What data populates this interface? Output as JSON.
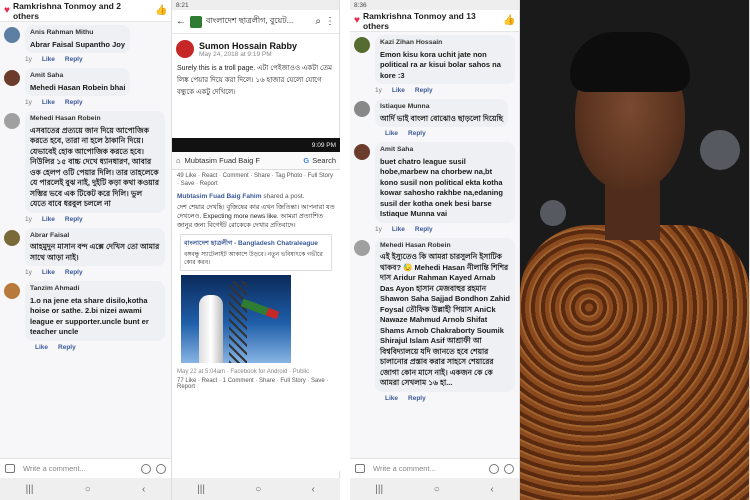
{
  "panel1": {
    "header": "Ramkrishna Tonmoy and 2 others",
    "comments": [
      {
        "name": "Anis Rahman Mithu",
        "text": "Abrar Faisal Supantho Joy",
        "time": "1y",
        "avatar": "#5c7fa3"
      },
      {
        "name": "Amit Saha",
        "text": "Mehedi Hasan Robein bhai",
        "time": "1y",
        "avatar": "#6b3b2b"
      },
      {
        "name": "Mehedi Hasan Robein",
        "text": "এসবাতের প্রত্যয়ে জান দিয়ে আপোজিক করতে হবে, তারা না হলে ঠাকানি দিয়ে। যেভাবেই হোক আপোজিক করতে হবে। নিউলির ১৫ বাচ্চ দেখে ধ্যানধারণ, আবার ওক হেলপ ওটি পেয়ার দিলি। তার তাহলেকে যে পারলেই বুঝ নাই, দুইটি কড়া কথা কওয়ার সম্ভির ভবে এক টিকেট করে দিলি। ভুল যেতে বাবে ধরবুল চললে না",
        "time": "1y",
        "avatar": "#a0a0a0"
      },
      {
        "name": "Abrar Faisal",
        "text": "আহমুদুন মাসান বন্দ এক্সে দেখিস তো আমার সাথে আড়া নাই।",
        "time": "1y",
        "avatar": "#7a6a3a"
      },
      {
        "name": "Tanzim Ahmadi",
        "text": "1.o na jene eta share disilo,kotha hoise or sathe. 2.bi nizei awami league er supporter.uncle bunt er teacher uncle",
        "time": "",
        "avatar": "#b87a3a"
      }
    ],
    "like": "Like",
    "reply": "Reply",
    "write_comment": "Write a comment..."
  },
  "panel2": {
    "status": "8:21",
    "group_title": "বাংলাদেশ ছাত্রলীগ, বুয়েট...",
    "poster": "Sumon Hossain Rabby",
    "date": "May 24, 2018 at 9:19 PM",
    "post_text": "Surely this is a troll page. এটা পেইজাওও একটা তেম লিঙ্ক পেয়ার দিয়ে করা দিলে। ১৬ হাজার যেলো যোগে বন্ধুকে একটু দেখিলে।",
    "inner_status": "9:09 PM",
    "url_name": "Mubtasim Fuad Baig F",
    "search": "Search",
    "reacts": "49 Like · React · Comment · Share · Tag Photo · Full Story · Save · Report",
    "share_line": "Mubtasim Fuad Baig Fahim",
    "share_suffix": "shared a post.",
    "inner_text": "দেশ শেয়ার দেখছি। বুজিষের কার এখন জিতিন্তা। আপনারা যত দেখলেও. Expecting more news like. আমরা প্রত্যাশিত জানুর জন্য বিগেইট রোকেকে দেখার প্রতিবাদে।",
    "embed_title": "বাংলাদেশ ছাত্রলীগ - Bangladesh Chatraleague",
    "embed_body": "বঙ্গবন্ধু স্যাটেলাইট আকাশে উড়বে। নতুন ভবিষ্যৎকে গভীরে কোর করব।",
    "footer": "May 22 at 5:04am · Facebook for Android · Public",
    "footer_acts": "77 Like · React · 1 Comment · Share · Full Story · Save · Report"
  },
  "panel3": {
    "status": "8:36",
    "header": "Ramkrishna Tonmoy and 13 others",
    "comments": [
      {
        "name": "Kazi Zihan Hossain",
        "text": "Emon kisu kora uchit jate non political ra ar kisui bolar sahos na kore :3",
        "time": "1y",
        "avatar": "#556b2f"
      },
      {
        "name": "Istiaque Munna",
        "text": "আর্দি ভাই বাংলা বোঝোও ছাড়লো দিয়েছি",
        "time": "",
        "avatar": "#888"
      },
      {
        "name": "Amit Saha",
        "text": "buet chatro league susil hobe,marbew na chorbew na,bt kono susil non political ekta kotha kowar sahosho rakhbe na,edaning susil der kotha onek besi barse Istiaque Munna vai",
        "time": "1y",
        "avatar": "#6b3b2b"
      },
      {
        "name": "Mehedi Hasan Robein",
        "text": "এই ইস্যুতেও কি আমরা চারসুলনি ইসাটিক থাকব? 😓 Mehedi Hasan নীলান্তি শিশির দাস Aridur Rahman Kayed Arnab Das Ayon হাসান মেজবাহুর রহমান Shawon Saha Sajjad Bondhon Zahid Foysal তৌফিক উল্লাহী পিয়াস AniCk Nawaze Mahmud Arnob Shifat Shams Arnob Chakraborty Soumik Shirajul Islam Asif আশ্রাফী আ বিশ্ববিদ্যালয়ে যদি জানতে হবে শেয়ার চালানোর প্রস্তাব করার সাহসে শেয়ারের জোগা কোন মাসে নাই। একজন কে কে আমরা সেখলাম ১৬ হা...",
        "time": "",
        "avatar": "#a0a0a0"
      }
    ],
    "like": "Like",
    "reply": "Reply",
    "see_more": "See",
    "write_comment": "Write a comment..."
  }
}
